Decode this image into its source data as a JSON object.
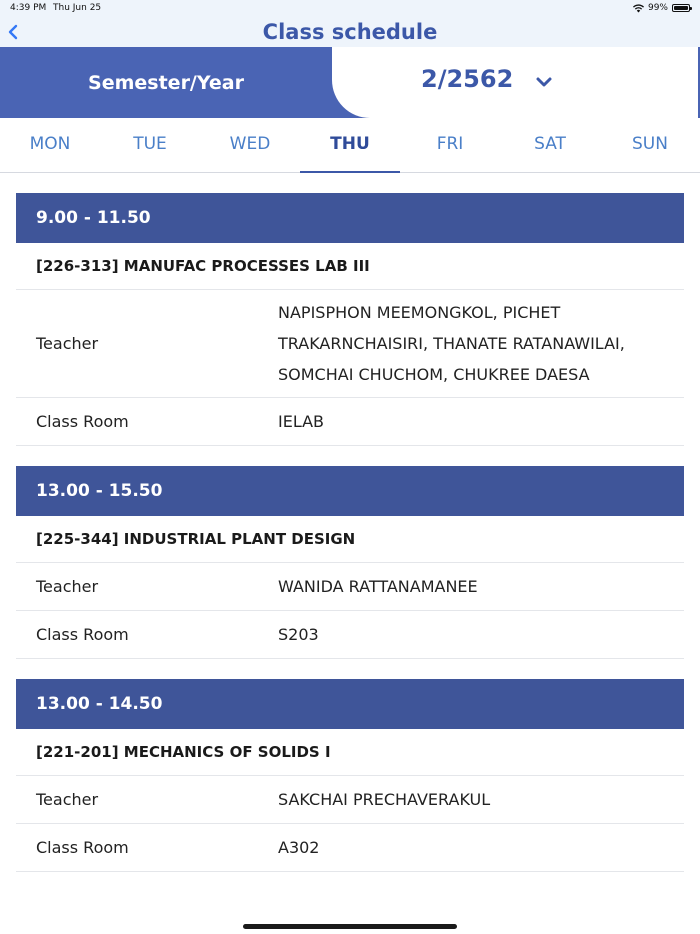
{
  "status_bar": {
    "time": "4:39 PM",
    "date": "Thu Jun 25",
    "battery": "99%",
    "battery_level": 0.99
  },
  "nav": {
    "title": "Class schedule",
    "back_icon": "chevron-left-icon"
  },
  "semester": {
    "label": "Semester/Year",
    "value": "2/2562",
    "dropdown_icon": "chevron-down-icon"
  },
  "days": [
    {
      "label": "MON",
      "active": false
    },
    {
      "label": "TUE",
      "active": false
    },
    {
      "label": "WED",
      "active": false
    },
    {
      "label": "THU",
      "active": true
    },
    {
      "label": "FRI",
      "active": false
    },
    {
      "label": "SAT",
      "active": false
    },
    {
      "label": "SUN",
      "active": false
    }
  ],
  "classes": [
    {
      "time": "9.00 - 11.50",
      "course": "[226-313] MANUFAC PROCESSES LAB III",
      "teacher_label": "Teacher",
      "teacher": "NAPISPHON MEEMONGKOL, PICHET TRAKARNCHAISIRI, THANATE RATANAWILAI, SOMCHAI CHUCHOM, CHUKREE DAESA",
      "room_label": "Class Room",
      "room": "IELAB"
    },
    {
      "time": "13.00 - 15.50",
      "course": "[225-344] INDUSTRIAL PLANT DESIGN",
      "teacher_label": "Teacher",
      "teacher": "WANIDA RATTANAMANEE",
      "room_label": "Class Room",
      "room": "S203"
    },
    {
      "time": "13.00 - 14.50",
      "course": "[221-201] MECHANICS OF SOLIDS I",
      "teacher_label": "Teacher",
      "teacher": "SAKCHAI PRECHAVERAKUL",
      "room_label": "Class Room",
      "room": "A302"
    }
  ],
  "colors": {
    "primary": "#3f5599",
    "accent": "#4a64b4",
    "tab_text": "#4a7fc8"
  }
}
